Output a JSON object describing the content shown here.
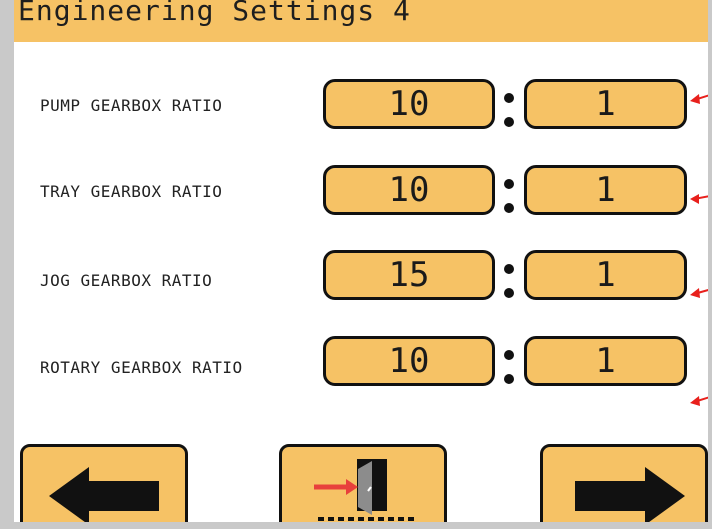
{
  "header": {
    "title": "Engineering Settings 4"
  },
  "rows": [
    {
      "label": "PUMP GEARBOX RATIO",
      "left_value": "10",
      "right_value": "1"
    },
    {
      "label": "TRAY GEARBOX RATIO",
      "left_value": "10",
      "right_value": "1"
    },
    {
      "label": "JOG GEARBOX RATIO",
      "left_value": "15",
      "right_value": "1"
    },
    {
      "label": "ROTARY GEARBOX RATIO",
      "left_value": "10",
      "right_value": "1"
    }
  ],
  "nav": {
    "back_icon": "arrow-left-icon",
    "exit_icon": "exit-door-icon",
    "next_icon": "arrow-right-icon"
  },
  "colors": {
    "panel": "#f6c265",
    "annotation_arrow": "#e8201c",
    "exit_arrow": "#e8403c",
    "door": "#8c8c8c"
  }
}
